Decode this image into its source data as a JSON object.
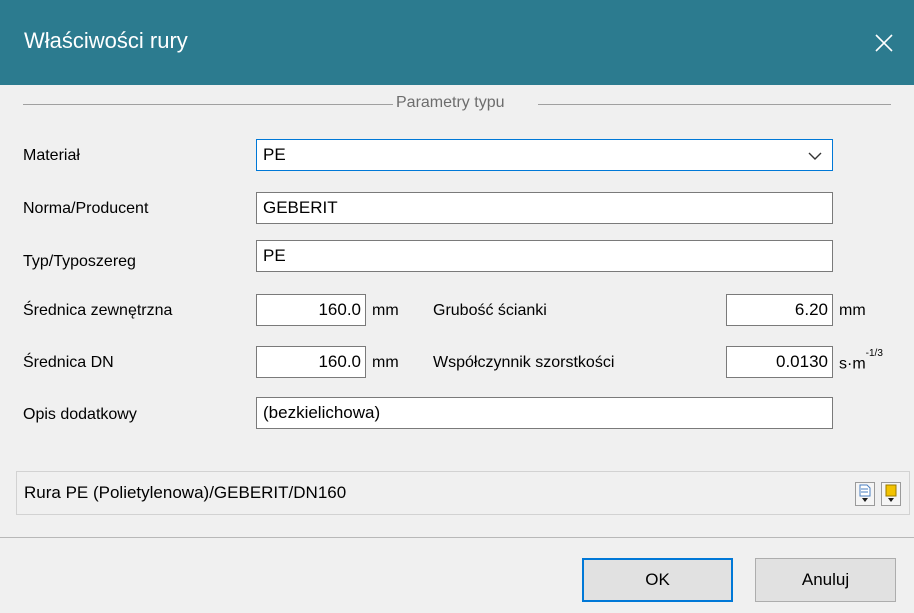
{
  "window": {
    "title": "Właściwości rury",
    "titlebar_color": "#2c7b8f",
    "close_icon": "close-icon"
  },
  "group": {
    "legend": "Parametry typu"
  },
  "fields": {
    "material": {
      "label": "Materiał",
      "value": "PE"
    },
    "norma": {
      "label": "Norma/Producent",
      "value": "GEBERIT"
    },
    "typ": {
      "label": "Typ/Typoszereg",
      "value": "PE"
    },
    "srednica_zew": {
      "label": "Średnica zewnętrzna",
      "value": "160.0",
      "unit": "mm"
    },
    "grubosc": {
      "label": "Grubość ścianki",
      "value": "6.20",
      "unit": "mm"
    },
    "srednica_dn": {
      "label": "Średnica DN",
      "value": "160.0",
      "unit": "mm"
    },
    "wspolczynnik": {
      "label": "Współczynnik szorstkości",
      "value": "0.0130",
      "unit_base": "s·m",
      "unit_sup": "-1/3"
    },
    "opis": {
      "label": "Opis dodatkowy",
      "value": "(bezkielichowa)"
    }
  },
  "status": {
    "text": "Rura PE (Polietylenowa)/GEBERIT/DN160",
    "icons": [
      "document-down-icon",
      "tag-down-icon"
    ]
  },
  "buttons": {
    "ok": "OK",
    "cancel": "Anuluj"
  },
  "accent_color": "#0078d7"
}
